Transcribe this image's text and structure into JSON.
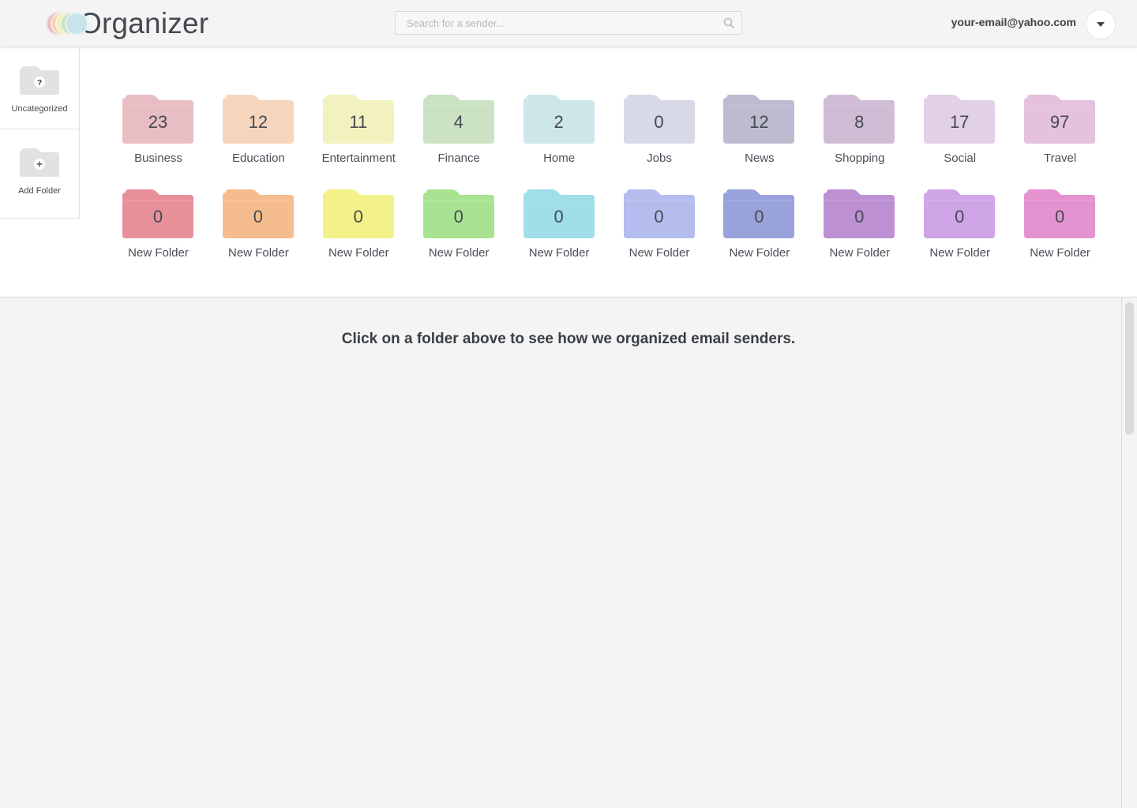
{
  "app": {
    "title": "Organizer",
    "logo_ring_colors": [
      "#e8b9c0",
      "#f3d3b3",
      "#f1f0b4",
      "#c9e2c2",
      "#c7e5ec"
    ]
  },
  "search": {
    "placeholder": "Search for a sender...",
    "value": "",
    "icon": "search-icon"
  },
  "user": {
    "email": "your-email@yahoo.com",
    "menu_icon": "caret-down-icon"
  },
  "sidebar": {
    "items": [
      {
        "label": "Uncategorized",
        "icon": "question-folder-icon"
      },
      {
        "label": "Add Folder",
        "icon": "add-folder-icon"
      }
    ]
  },
  "folders": {
    "row1": [
      {
        "name": "Business",
        "count": "23",
        "color": "#e8bec4"
      },
      {
        "name": "Education",
        "count": "12",
        "color": "#f5d5bc"
      },
      {
        "name": "Entertainment",
        "count": "11",
        "color": "#f1f2bd"
      },
      {
        "name": "Finance",
        "count": "4",
        "color": "#cbe3c3"
      },
      {
        "name": "Home",
        "count": "2",
        "color": "#cde6ea"
      },
      {
        "name": "Jobs",
        "count": "0",
        "color": "#d7d9e6"
      },
      {
        "name": "News",
        "count": "12",
        "color": "#bdbbd0"
      },
      {
        "name": "Shopping",
        "count": "8",
        "color": "#d0bcd5"
      },
      {
        "name": "Social",
        "count": "17",
        "color": "#e2d0e7"
      },
      {
        "name": "Travel",
        "count": "97",
        "color": "#e4c1dd"
      }
    ],
    "row2": [
      {
        "name": "New Folder",
        "count": "0",
        "color": "#e7909a"
      },
      {
        "name": "New Folder",
        "count": "0",
        "color": "#f5bd8e"
      },
      {
        "name": "New Folder",
        "count": "0",
        "color": "#f2f288"
      },
      {
        "name": "New Folder",
        "count": "0",
        "color": "#a8e392"
      },
      {
        "name": "New Folder",
        "count": "0",
        "color": "#a0dee8"
      },
      {
        "name": "New Folder",
        "count": "0",
        "color": "#b4bdee"
      },
      {
        "name": "New Folder",
        "count": "0",
        "color": "#9aa2db"
      },
      {
        "name": "New Folder",
        "count": "0",
        "color": "#bd90d3"
      },
      {
        "name": "New Folder",
        "count": "0",
        "color": "#d0a5e8"
      },
      {
        "name": "New Folder",
        "count": "0",
        "color": "#e592d0"
      }
    ]
  },
  "main": {
    "hint": "Click on a folder above to see how we organized email senders."
  }
}
